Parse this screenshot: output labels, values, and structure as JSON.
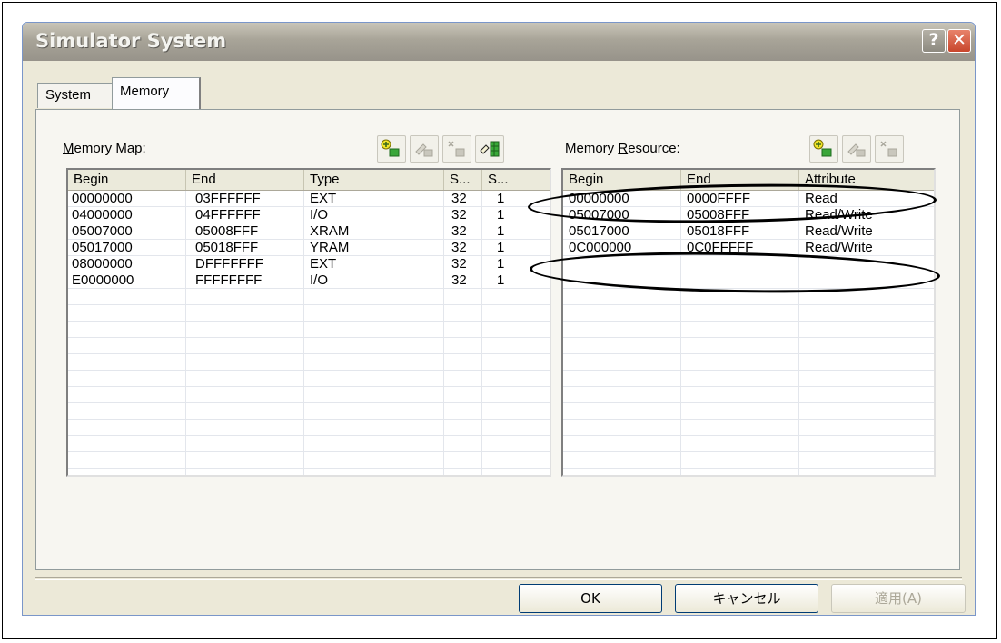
{
  "window": {
    "title": "Simulator System",
    "help_glyph": "?",
    "close_glyph": "✕"
  },
  "tabs": [
    {
      "label": "System"
    },
    {
      "label": "Memory"
    }
  ],
  "memory_map": {
    "label_prefix": "M",
    "label_rest": "emory Map:",
    "columns": [
      "Begin",
      "End",
      "Type",
      "S...",
      "S..."
    ],
    "rows": [
      [
        "00000000",
        "03FFFFFF",
        "EXT",
        "32",
        "1"
      ],
      [
        "04000000",
        "04FFFFFF",
        "I/O",
        "32",
        "1"
      ],
      [
        "05007000",
        "05008FFF",
        "XRAM",
        "32",
        "1"
      ],
      [
        "05017000",
        "05018FFF",
        "YRAM",
        "32",
        "1"
      ],
      [
        "08000000",
        "DFFFFFFF",
        "EXT",
        "32",
        "1"
      ],
      [
        "E0000000",
        "FFFFFFFF",
        "I/O",
        "32",
        "1"
      ]
    ]
  },
  "memory_resource": {
    "label_prefix": "Memory ",
    "label_accel": "R",
    "label_rest": "esource:",
    "columns": [
      "Begin",
      "End",
      "Attribute"
    ],
    "rows": [
      [
        "00000000",
        "0000FFFF",
        "Read"
      ],
      [
        "05007000",
        "05008FFF",
        "Read/Write"
      ],
      [
        "05017000",
        "05018FFF",
        "Read/Write"
      ],
      [
        "0C000000",
        "0C0FFFFF",
        "Read/Write"
      ]
    ]
  },
  "buttons": {
    "ok": "OK",
    "cancel": "キャンセル",
    "apply": "適用(A)"
  },
  "icons": [
    "add-icon",
    "edit-icon",
    "delete-icon",
    "verify-icon"
  ],
  "colors": {
    "dialog_bg": "#ece9d8",
    "titlebar": "#a8a498",
    "close_red": "#c8462c",
    "annotation": "#000000"
  }
}
